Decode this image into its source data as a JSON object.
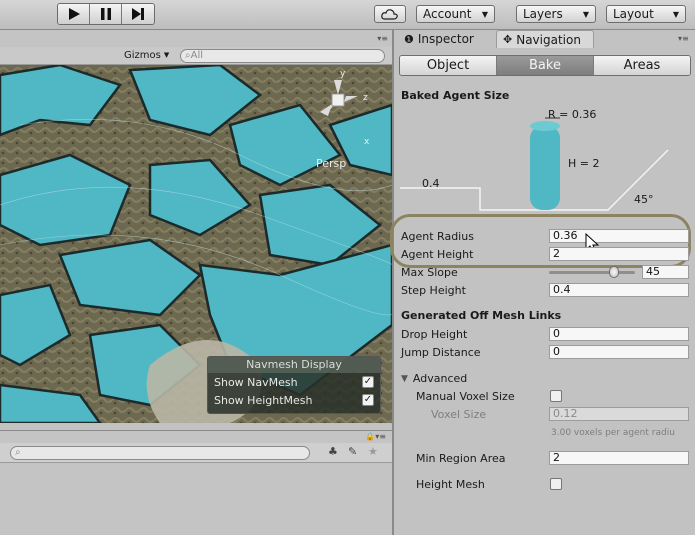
{
  "toolbar": {
    "account_label": "Account",
    "layers_label": "Layers",
    "layout_label": "Layout"
  },
  "scene": {
    "gizmos_label": "Gizmos",
    "search_placeholder": "All",
    "persp_label": "Persp",
    "navmesh_display": {
      "title": "Navmesh Display",
      "show_navmesh_label": "Show NavMesh",
      "show_navmesh_checked": true,
      "show_heightmesh_label": "Show HeightMesh",
      "show_heightmesh_checked": true
    }
  },
  "tabs": {
    "inspector_label": "Inspector",
    "navigation_label": "Navigation"
  },
  "segments": {
    "object_label": "Object",
    "bake_label": "Bake",
    "areas_label": "Areas",
    "active": "Bake"
  },
  "agent_size": {
    "title": "Baked Agent Size",
    "r_label": "R = 0.36",
    "h_label": "H = 2",
    "step_label": "0.4",
    "angle_label": "45°"
  },
  "fields": {
    "agent_radius_label": "Agent Radius",
    "agent_radius_value": "0.36",
    "agent_height_label": "Agent Height",
    "agent_height_value": "2",
    "max_slope_label": "Max Slope",
    "max_slope_value": "45",
    "max_slope_fraction": 0.75,
    "step_height_label": "Step Height",
    "step_height_value": "0.4"
  },
  "offmesh": {
    "title": "Generated Off Mesh Links",
    "drop_height_label": "Drop Height",
    "drop_height_value": "0",
    "jump_distance_label": "Jump Distance",
    "jump_distance_value": "0"
  },
  "advanced": {
    "label": "Advanced",
    "manual_voxel_label": "Manual Voxel Size",
    "voxel_size_label": "Voxel Size",
    "voxel_size_value": "0.12",
    "voxel_hint": "3.00 voxels per agent radiu",
    "min_region_label": "Min Region Area",
    "min_region_value": "2",
    "height_mesh_label": "Height Mesh"
  },
  "colors": {
    "accent_teal": "#4fb8c4",
    "highlight_ring": "#8c8460",
    "active_segment": "#8a8a8a"
  }
}
